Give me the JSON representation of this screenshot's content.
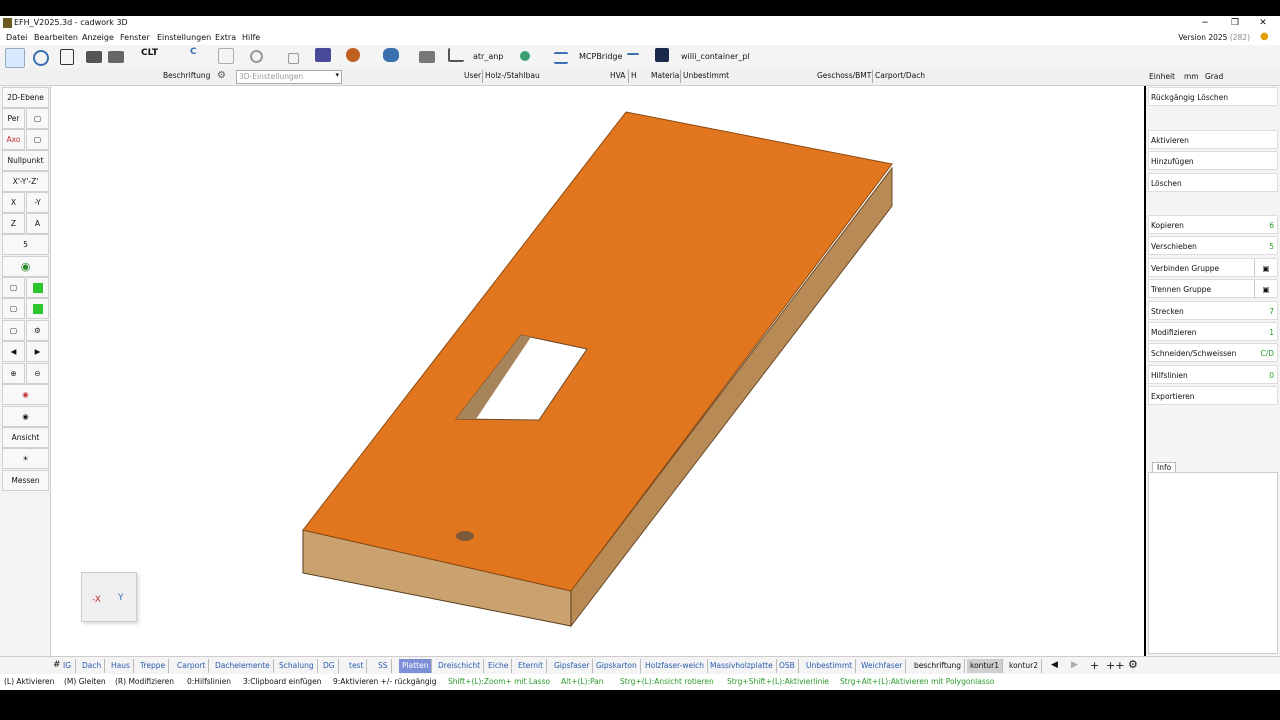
{
  "window": {
    "title": "EFH_V2025.3d - cadwork 3D",
    "minimize": "−",
    "restore": "❐",
    "close": "✕"
  },
  "menu": [
    "Datei",
    "Bearbeiten",
    "Anzeige",
    "Fenster",
    "Einstellungen",
    "Extra",
    "Hilfe"
  ],
  "version": {
    "label": "Version 2025",
    "build": "(282)"
  },
  "toolbar": {
    "clt": "CLT",
    "c": "C",
    "atr_anp": "atr_anp",
    "mcpbridge": "MCPBridge",
    "container": "willi_container_pl"
  },
  "infobar": {
    "beschriftung": "Beschriftung",
    "settings": "3D-Einstellungen",
    "user": "User",
    "user_value": "Holz-/Stahlbau",
    "hva": "HVA",
    "h": "H",
    "material": "Material",
    "material_value": "Unbestimmt",
    "geschoss": "Geschoss/BMT",
    "geschoss_value": "Carport/Dach",
    "einheit": "Einheit",
    "unit": "mm",
    "angle": "Grad"
  },
  "left": {
    "ebene": "2D-Ebene",
    "per": "Per",
    "axo": "Axo",
    "nullpunkt": "Nullpunkt",
    "xyz": "X'-Y'-Z'",
    "x": "X",
    "my": "-Y",
    "z": "Z",
    "a": "A",
    "five": "5",
    "ansicht": "Ansicht",
    "messen": "Messen"
  },
  "right": {
    "undo": "Rückgängig Löschen",
    "items": [
      {
        "label": "Aktivieren",
        "num": ""
      },
      {
        "label": "Hinzufügen",
        "num": ""
      },
      {
        "label": "Löschen",
        "num": ""
      },
      {
        "label": "Kopieren",
        "num": "6"
      },
      {
        "label": "Verschieben",
        "num": "5"
      },
      {
        "label": "Verbinden Gruppe",
        "num": ""
      },
      {
        "label": "Trennen Gruppe",
        "num": ""
      },
      {
        "label": "Strecken",
        "num": "7"
      },
      {
        "label": "Modifizieren",
        "num": "1"
      },
      {
        "label": "Schneiden/Schweissen",
        "num": "C/D"
      },
      {
        "label": "Hilfslinien",
        "num": "0"
      },
      {
        "label": "Exportieren",
        "num": ""
      }
    ],
    "info": "Info"
  },
  "viewcube": {
    "x": "-X",
    "y": "Y"
  },
  "tabs": [
    "IG",
    "Dach",
    "Haus",
    "Treppe",
    "Carport",
    "Dachelemente",
    "Schalung",
    "DG",
    "test",
    "SS",
    "Platten",
    "Dreischicht",
    "Eiche",
    "Eternit",
    "Gipsfaser",
    "Gipskarton",
    "Holzfaser-weich",
    "Massivholzplatte",
    "OSB",
    "Unbestimmt",
    "Weichfaser",
    "beschriftung",
    "kontur1",
    "kontur2"
  ],
  "tabs_active": "Platten",
  "status": [
    {
      "text": "(L) Aktivieren",
      "green": false
    },
    {
      "text": "(M) Gleiten",
      "green": false
    },
    {
      "text": "(R) Modifizieren",
      "green": false
    },
    {
      "text": "0:Hilfslinien",
      "green": false
    },
    {
      "text": "3:Clipboard einfügen",
      "green": false
    },
    {
      "text": "9:Aktivieren +/- rückgängig",
      "green": false
    },
    {
      "text": "Shift+(L):Zoom+ mit Lasso",
      "green": true
    },
    {
      "text": "Alt+(L):Pan",
      "green": true
    },
    {
      "text": "Strg+(L):Ansicht rotieren",
      "green": true
    },
    {
      "text": "Strg+Shift+(L):Aktivierlinie",
      "green": true
    },
    {
      "text": "Strg+Alt+(L):Aktivieren mit Polygonlasso",
      "green": true
    }
  ],
  "colors": {
    "panel_top": "#e2761f",
    "panel_edge": "#b07a45",
    "tab_active": "#7d8fd6"
  }
}
